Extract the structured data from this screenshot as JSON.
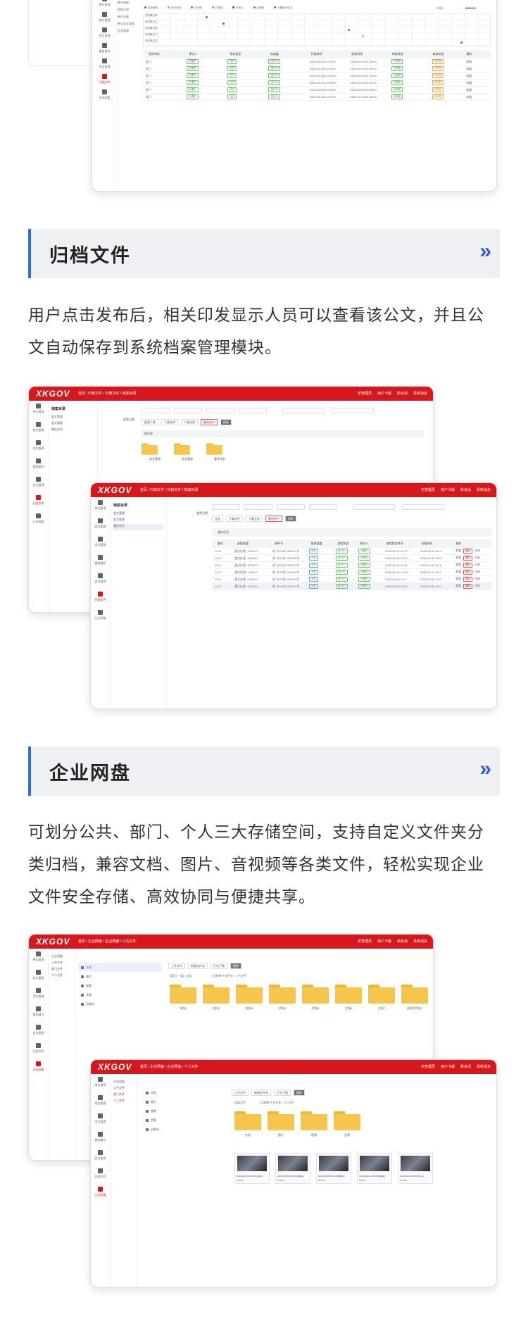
{
  "section1": {
    "title": "归档文件",
    "description": "用户点击发布后，相关印发显示人员可以查看该公文，并且公文自动保存到系统档案管理模块。"
  },
  "section2": {
    "title": "企业网盘",
    "description": "可划分公共、部门、个人三大存储空间，支持自定义文件夹分类归档，兼容文档、图片、音视频等各类文件，轻松实现企业文件安全存储、高效协同与便捷共享。"
  },
  "chevron": "»",
  "app": {
    "logo": "XKGOV",
    "topbar_right": [
      "定管理员",
      "用户卡解",
      "新会话",
      "系统消息"
    ]
  },
  "top_screenshot": {
    "sidebar": [
      "单位管理",
      "收文管理",
      "发文管理",
      "督查督办",
      "会议管理",
      "归档文件",
      "企业网盘"
    ],
    "submenu": [
      "单位审核",
      "流程记录",
      "单位分级",
      "单位发文管理",
      "业务管理"
    ],
    "legend": [
      "当前审核",
      "已收未阅",
      "已办理",
      "已完成",
      "已终止",
      "已回退",
      "已撤回/已出文"
    ],
    "year_label": "年份",
    "year_value": "2026-03",
    "units": [
      "测试单位甲",
      "测试单位乙",
      "测试单位丙",
      "测试单位丁",
      "测试单位戊"
    ],
    "table_headers": [
      "承办单位",
      "牵头人",
      "承办类型",
      "完成度",
      "开始时间",
      "结束时间",
      "审核状态",
      "审核状态",
      "操作"
    ],
    "rows": [
      {
        "unit": "部门",
        "lead": "办理中",
        "type": "协办",
        "progress": "进行中",
        "start": "2026-03-28 01:00:00",
        "end": "2026-03-29 01:00:00",
        "status": "已审核",
        "state": "待审核",
        "op": "查看"
      },
      {
        "unit": "部门",
        "lead": "办理中",
        "type": "协办",
        "progress": "进行中",
        "start": "2026-03-28 01:00:00",
        "end": "2026-03-29 01:00:00",
        "status": "已审核",
        "state": "待审核",
        "op": "查看"
      },
      {
        "unit": "部门",
        "lead": "办理中",
        "type": "协办",
        "progress": "进行中",
        "start": "2026-03-28 01:00:00",
        "end": "2026-03-29 01:00:00",
        "status": "已审核",
        "state": "待审核",
        "op": "查看"
      },
      {
        "unit": "部门",
        "lead": "办理中",
        "type": "协办",
        "progress": "进行中",
        "start": "2026-03-28 01:00:00",
        "end": "2026-03-29 01:00:00",
        "status": "已审核",
        "state": "待审核",
        "op": "查看"
      },
      {
        "unit": "部门",
        "lead": "办理中",
        "type": "协办",
        "progress": "进行中",
        "start": "2026-03-28 01:00:00",
        "end": "2026-03-29 01:00:00",
        "status": "已审核",
        "state": "待审核",
        "op": "查看"
      },
      {
        "unit": "部门",
        "lead": "办理中",
        "type": "协办",
        "progress": "进行中",
        "start": "2026-03-28 01:00:00",
        "end": "2026-03-29 01:00:00",
        "status": "已审核",
        "state": "待审核",
        "op": "查看"
      }
    ]
  },
  "archive_back": {
    "crumb": "首页 / 归档文件 / 归档文件 / 档案目录",
    "tree_title": "档案目录",
    "tree_items": [
      "收文管理",
      "发文管理",
      "督办任务"
    ],
    "reset": "重置设置",
    "buttons": [
      "批量下载",
      "下载选中",
      "下载全部",
      "删除选中",
      "刷新"
    ],
    "path": "根目录",
    "folders": [
      "收文管理",
      "发文管理",
      "督办任务"
    ]
  },
  "archive_front": {
    "crumb": "首页 / 归档文件 / 归档文件 / 档案目录",
    "tree_title": "档案目录",
    "tree_items": [
      "收文管理",
      "发文管理",
      "督办任务"
    ],
    "reset": "重置设置",
    "buttons": [
      "全选",
      "下载选中",
      "下载全部",
      "删除选中",
      "刷新"
    ],
    "path": "督办任务",
    "headers": [
      "编号",
      "流程标题",
      "原件号",
      "紧急程度",
      "流程状态",
      "承办人",
      "流程提交时间",
      "归档时间",
      "操作"
    ],
    "rows": [
      {
        "id": "1/1/4",
        "title": "督文处理（2026-0...",
        "no": "收【2026】000017号",
        "urgency": "平件",
        "state": "进行中",
        "owner": "办理中",
        "submitted": "2026-05-15 10:17...",
        "archived": "2026-05-15 10:1...",
        "op1": "查看",
        "op2": "删除",
        "op3": "归档"
      },
      {
        "id": "1/1/4",
        "title": "督文处理（2026-0...",
        "no": "收【2026】000016号",
        "urgency": "平件",
        "state": "进行中",
        "owner": "办理中",
        "submitted": "2026-04-15 12:50...",
        "archived": "2026-04-15 12:5...",
        "op1": "查看",
        "op2": "删除",
        "op3": "归档"
      },
      {
        "id": "1/1/4",
        "title": "督文处理（2026-0...",
        "no": "收【2026】000015号",
        "urgency": "平件",
        "state": "进行中",
        "owner": "办理中",
        "submitted": "2026-04-15 12:46...",
        "archived": "2026-04-15 12:4...",
        "op1": "查看",
        "op2": "删除",
        "op3": "归档"
      },
      {
        "id": "1/1/4",
        "title": "督文处理（2026-0...",
        "no": "收【2026】000014号",
        "urgency": "平件",
        "state": "进行中",
        "owner": "办理中",
        "submitted": "2026-04-15 12:46...",
        "archived": "2026-04-15 12:4...",
        "op1": "查看",
        "op2": "删除",
        "op3": "归档"
      },
      {
        "id": "1/1/4",
        "title": "督文处理（2026-0...",
        "no": "收【2026】000013号",
        "urgency": "平件",
        "state": "进行中",
        "owner": "办理中",
        "submitted": "2026-04-08 14:2...",
        "archived": "2026-04-08 14:2...",
        "op1": "查看",
        "op2": "删除",
        "op3": "归档"
      },
      {
        "id": "1/1/4",
        "title": "督文处理（2026-0...",
        "no": "收【2026】000012号",
        "urgency": "平件",
        "state": "进行中",
        "owner": "办理中",
        "submitted": "2026-04-08 14:21...",
        "archived": "2026-04-08 14:2...",
        "op1": "查看",
        "op2": "删除",
        "op3": "归档"
      }
    ]
  },
  "disk_back": {
    "crumb": "首页 / 企业网盘 / 企业网盘 / 公共文件",
    "tree_items": [
      "企业网盘",
      "公共文件",
      "部门文件",
      "个人文件"
    ],
    "categories": [
      "文档",
      "图片",
      "视频",
      "音频",
      "回收站"
    ],
    "buttons": [
      "上传文件",
      "新建文件夹",
      "打包下载",
      "删除"
    ],
    "path": "返回上一级 / 文档",
    "summary": "已选择0个文件夹，0个文件",
    "folders": [
      "文档1",
      "文档2",
      "文档3",
      "文档4",
      "文档5",
      "文档6",
      "文档7",
      "测试文件夹1"
    ]
  },
  "disk_front": {
    "crumb": "首页 / 企业网盘 / 企业网盘 / 个人文件",
    "tree_items": [
      "企业网盘",
      "公共文件",
      "部门文件",
      "个人文件"
    ],
    "categories": [
      "文档",
      "图片",
      "视频",
      "音频",
      "回收站"
    ],
    "buttons": [
      "上传文件",
      "新建文件夹",
      "打包下载",
      "删除"
    ],
    "path": "全部文件",
    "summary": "已选择0个文件夹，0个文件",
    "folders": [
      "文档",
      "图片",
      "视频",
      "音频"
    ],
    "images": [
      {
        "name": "20210930141754265 副本1.png",
        "size": "51.8Kb"
      },
      {
        "name": "20210930141754265 副本2.png",
        "size": "51.8Kb"
      },
      {
        "name": "20210930141754265 副本3.png",
        "size": "51.8Kb"
      },
      {
        "name": "20210930141754265 副本4.png",
        "size": "51.8Kb"
      },
      {
        "name": "20210930141754265.png",
        "size": "51.8Kb"
      }
    ]
  },
  "colors": {
    "brand_red": "#d6171c",
    "accent_blue": "#2f6fe0",
    "folder": "#f5c54e"
  }
}
